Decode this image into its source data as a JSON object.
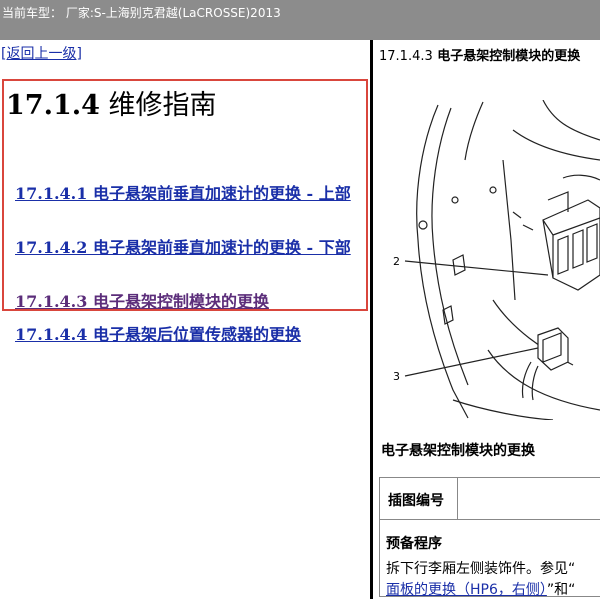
{
  "topbar": {
    "text": "当前车型：  厂家:S-上海别克君越(LaCROSSE)2013"
  },
  "left": {
    "back_link": "[返回上一级]",
    "title_number": "17.1.4",
    "title_text": " 维修指南",
    "links": [
      "17.1.4.1 电子悬架前垂直加速计的更换 - 上部",
      "17.1.4.2 电子悬架前垂直加速计的更换 - 下部",
      "17.1.4.3 电子悬架控制模块的更换",
      "17.1.4.4 电子悬架后位置传感器的更换"
    ]
  },
  "right": {
    "heading_number": "17.1.4.3",
    "heading_text": " 电子悬架控制模块的更换",
    "figure_callouts": [
      "2",
      "3"
    ],
    "section_heading": "电子悬架控制模块的更换",
    "table": {
      "header": "插图编号",
      "prep_label": "预备程序",
      "prep_text": "拆下行李厢左侧装饰件。参见“",
      "prep_link": "面板的更换（HP6，右侧）",
      "prep_after": "”和“"
    }
  },
  "colors": {
    "topbar_bg": "#8c8c8c",
    "link": "#1a2fa8",
    "visited_link": "#5b2d7a",
    "highlight_border": "#d9463c"
  }
}
